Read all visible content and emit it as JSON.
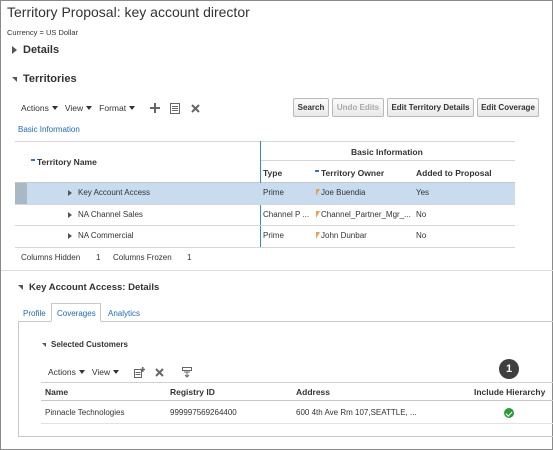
{
  "page": {
    "title": "Territory Proposal: key account director",
    "currency": "Currency = US Dollar"
  },
  "details_section": {
    "label": "Details"
  },
  "territories_section": {
    "label": "Territories",
    "toolbar": {
      "actions": "Actions",
      "view": "View",
      "format": "Format",
      "search": "Search",
      "undo_edits": "Undo Edits",
      "edit_territory_details": "Edit Territory Details",
      "edit_coverage": "Edit Coverage"
    },
    "basic_information_link": "Basic Information",
    "table": {
      "group_header": "Basic Information",
      "columns": [
        "Territory Name",
        "Type",
        "Territory Owner",
        "Added to Proposal"
      ],
      "rows": [
        {
          "name": "Key Account Access",
          "type": "Prime",
          "owner": "Joe Buendia",
          "added": "Yes"
        },
        {
          "name": "NA Channel Sales",
          "type": "Channel P ...",
          "owner": "Channel_Partner_Mgr_...",
          "added": "No"
        },
        {
          "name": "NA Commercial",
          "type": "Prime",
          "owner": "John Dunbar",
          "added": "No"
        }
      ],
      "footer": {
        "columns_hidden_label": "Columns Hidden",
        "columns_hidden_value": "1",
        "columns_frozen_label": "Columns Frozen",
        "columns_frozen_value": "1"
      }
    }
  },
  "details_panel": {
    "label": "Key Account Access: Details",
    "tabs": [
      "Profile",
      "Coverages",
      "Analytics"
    ],
    "active_tab": "Coverages",
    "selected_customers": {
      "label": "Selected Customers",
      "toolbar": {
        "actions": "Actions",
        "view": "View"
      },
      "columns": [
        "Name",
        "Registry ID",
        "Address",
        "Include Hierarchy"
      ],
      "rows": [
        {
          "name": "Pinnacle Technologies",
          "registry_id": "999997569264400",
          "address": "600 4th Ave Rm 107,SEATTLE, ...",
          "include_hierarchy": true
        }
      ],
      "callout_number": "1"
    }
  },
  "colors": {
    "selected_row": "#c9dbee",
    "link": "#1f6bb5",
    "check": "#2c9a3d",
    "badge": "#3f3f3f"
  }
}
